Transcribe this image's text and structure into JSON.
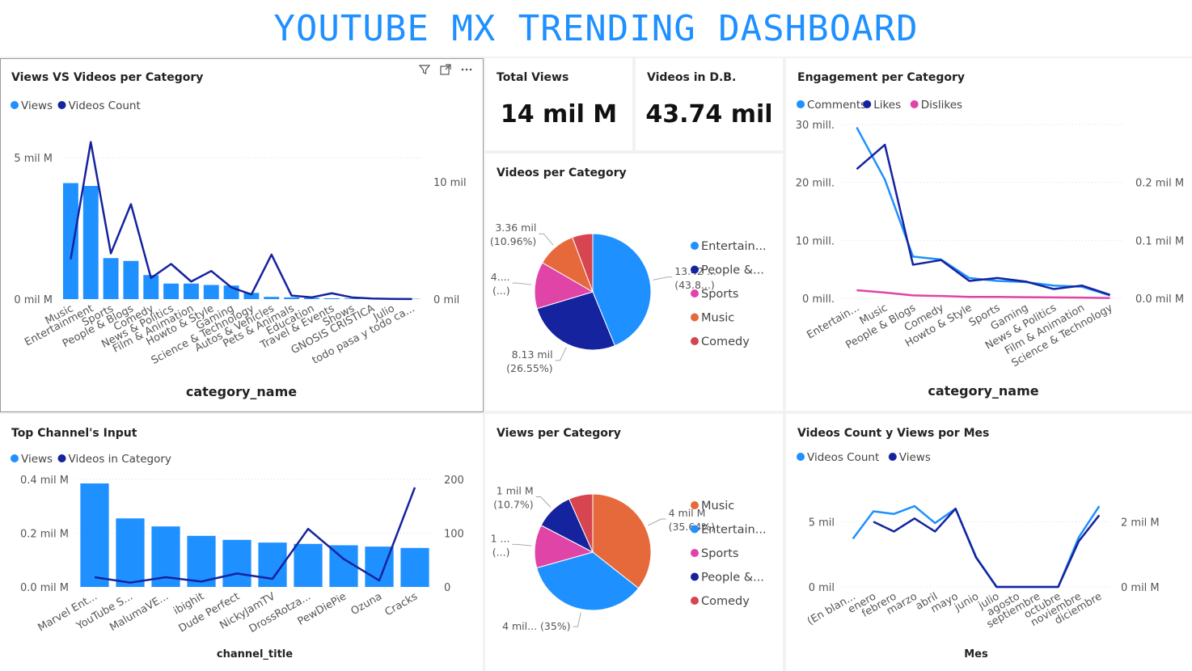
{
  "dashboard_title": "YOUTUBE MX TRENDING DASHBOARD",
  "colors": {
    "views": "#1E90FF",
    "videos": "#15239E",
    "pink": "#E044A7",
    "orange": "#E5693A",
    "red": "#D64550"
  },
  "icons": [
    "filter-icon",
    "focus-mode-icon",
    "more-options-icon"
  ],
  "kpi_total_views": {
    "label": "Total Views",
    "value": "14 mil M"
  },
  "kpi_videos": {
    "label": "Videos in D.B.",
    "value": "43.74 mil"
  },
  "chart_data": [
    {
      "id": "views_vs_videos",
      "type": "bar",
      "title": "Views VS Videos per Category",
      "xlabel": "category_name",
      "legend": [
        "Views",
        "Videos Count"
      ],
      "categories": [
        "Music",
        "Entertainment",
        "Sports",
        "People & Blogs",
        "Comedy",
        "News & Politics",
        "Film & Animation",
        "Howto & Style",
        "Gaming",
        "Science & Technology",
        "Autos & Vehicles",
        "Pets & Animals",
        "Education",
        "Travel & Events",
        "Shows",
        "GNOSIS CRISTICA",
        "Julio",
        "todo pasa y todo ca..."
      ],
      "series": [
        {
          "name": "Views",
          "axis": "left",
          "kind": "bar",
          "values": [
            4.1,
            4.0,
            1.45,
            1.35,
            0.85,
            0.55,
            0.55,
            0.5,
            0.48,
            0.22,
            0.08,
            0.06,
            0.04,
            0.03,
            0.02,
            0.01,
            0.01,
            0.01
          ]
        },
        {
          "name": "Videos Count",
          "axis": "right",
          "kind": "line",
          "values": [
            3.4,
            13.4,
            3.9,
            8.1,
            1.8,
            3.0,
            1.5,
            2.4,
            1.0,
            0.4,
            3.8,
            0.3,
            0.15,
            0.5,
            0.15,
            0.05,
            0.02,
            0.01
          ]
        }
      ],
      "y_left": {
        "min": 0,
        "max": 5.8,
        "ticks": [
          {
            "v": 0,
            "label": "0 mil M"
          },
          {
            "v": 5,
            "label": "5 mil M"
          }
        ]
      },
      "y_right": {
        "min": 0,
        "max": 14,
        "ticks": [
          {
            "v": 0,
            "label": "0 mil"
          },
          {
            "v": 10,
            "label": "10 mil"
          }
        ]
      }
    },
    {
      "id": "videos_per_category",
      "type": "pie",
      "title": "Videos per Category",
      "slices": [
        {
          "name": "Entertainment",
          "legend_label": "Entertain...",
          "value": 43.8,
          "color": "#1E90FF",
          "label1": "13.42 ...",
          "label2": "(43.8...)"
        },
        {
          "name": "People & Blogs",
          "legend_label": "People &...",
          "value": 26.55,
          "color": "#15239E",
          "label1": "8.13 mil",
          "label2": "(26.55%)"
        },
        {
          "name": "Sports",
          "legend_label": "Sports",
          "value": 13.0,
          "color": "#E044A7",
          "label1": "4....",
          "label2": "(...)"
        },
        {
          "name": "Music",
          "legend_label": "Music",
          "value": 10.96,
          "color": "#E5693A",
          "label1": "3.36 mil",
          "label2": "(10.96%)"
        },
        {
          "name": "Comedy",
          "legend_label": "Comedy",
          "value": 5.69,
          "color": "#D64550",
          "label1": "",
          "label2": ""
        }
      ]
    },
    {
      "id": "engagement",
      "type": "line",
      "title": "Engagement per Category",
      "xlabel": "category_name",
      "legend": [
        "Comments",
        "Likes",
        "Dislikes"
      ],
      "categories": [
        "Entertain...",
        "Music",
        "People & Blogs",
        "Comedy",
        "Howto & Style",
        "Sports",
        "Gaming",
        "News & Politics",
        "Film & Animation",
        "Science & Technology"
      ],
      "series": [
        {
          "name": "Comments",
          "axis": "right",
          "values": [
            0.295,
            0.205,
            0.072,
            0.067,
            0.035,
            0.03,
            0.028,
            0.022,
            0.02,
            0.005
          ]
        },
        {
          "name": "Likes",
          "axis": "left",
          "values": [
            22.3,
            26.5,
            5.8,
            6.6,
            3.0,
            3.5,
            2.9,
            1.6,
            2.2,
            0.6
          ]
        },
        {
          "name": "Dislikes",
          "axis": "left",
          "values": [
            1.4,
            1.0,
            0.5,
            0.4,
            0.25,
            0.25,
            0.2,
            0.15,
            0.12,
            0.05
          ]
        }
      ],
      "y_left": {
        "min": 0,
        "max": 30,
        "ticks": [
          {
            "v": 0,
            "label": "0 mill."
          },
          {
            "v": 10,
            "label": "10 mill."
          },
          {
            "v": 20,
            "label": "20 mill."
          },
          {
            "v": 30,
            "label": "30 mill."
          }
        ]
      },
      "y_right": {
        "min": 0,
        "max": 0.3,
        "ticks": [
          {
            "v": 0,
            "label": "0.0 mil M"
          },
          {
            "v": 0.1,
            "label": "0.1 mil M"
          },
          {
            "v": 0.2,
            "label": "0.2 mil M"
          }
        ]
      }
    },
    {
      "id": "top_channels",
      "type": "bar",
      "title": "Top Channel's Input",
      "xlabel": "channel_title",
      "legend": [
        "Views",
        "Videos in Category"
      ],
      "categories": [
        "Marvel Ent...",
        "YouTube S...",
        "MalumaVE...",
        "ibighit",
        "Dude Perfect",
        "NickyJamTV",
        "DrossRotza...",
        "PewDiePie",
        "Ozuna",
        "Cracks"
      ],
      "series": [
        {
          "name": "Views",
          "axis": "left",
          "kind": "bar",
          "values": [
            0.385,
            0.255,
            0.225,
            0.19,
            0.175,
            0.165,
            0.16,
            0.155,
            0.15,
            0.145
          ]
        },
        {
          "name": "Videos in Category",
          "axis": "right",
          "kind": "line",
          "values": [
            18,
            8,
            18,
            10,
            25,
            15,
            108,
            52,
            12,
            185
          ]
        }
      ],
      "y_left": {
        "min": 0,
        "max": 0.4,
        "ticks": [
          {
            "v": 0,
            "label": "0.0 mil M"
          },
          {
            "v": 0.2,
            "label": "0.2 mil M"
          },
          {
            "v": 0.4,
            "label": "0.4 mil M"
          }
        ]
      },
      "y_right": {
        "min": 0,
        "max": 200,
        "ticks": [
          {
            "v": 0,
            "label": "0"
          },
          {
            "v": 100,
            "label": "100"
          },
          {
            "v": 200,
            "label": "200"
          }
        ]
      }
    },
    {
      "id": "views_per_category",
      "type": "pie",
      "title": "Views per Category",
      "slices": [
        {
          "name": "Music",
          "legend_label": "Music",
          "value": 35.64,
          "color": "#E5693A",
          "label1": "4 mil M",
          "label2": "(35.64%)"
        },
        {
          "name": "Entertainment",
          "legend_label": "Entertain...",
          "value": 35.0,
          "color": "#1E90FF",
          "label1": "4 mil... (35%)",
          "label2": ""
        },
        {
          "name": "Sports",
          "legend_label": "Sports",
          "value": 12.0,
          "color": "#E044A7",
          "label1": "1 ...",
          "label2": "(...)"
        },
        {
          "name": "People & Blogs",
          "legend_label": "People &...",
          "value": 10.7,
          "color": "#15239E",
          "label1": "1 mil M",
          "label2": "(10.7%)"
        },
        {
          "name": "Comedy",
          "legend_label": "Comedy",
          "value": 6.66,
          "color": "#D64550",
          "label1": "",
          "label2": ""
        }
      ]
    },
    {
      "id": "monthly",
      "type": "line",
      "title": "Videos Count y Views por Mes",
      "xlabel": "Mes",
      "legend": [
        "Videos Count",
        "Views"
      ],
      "categories": [
        "(En blan...",
        "enero",
        "febrero",
        "marzo",
        "abril",
        "mayo",
        "junio",
        "julio",
        "agosto",
        "septiembre",
        "octubre",
        "noviembre",
        "diciembre"
      ],
      "series": [
        {
          "name": "Videos Count",
          "axis": "left",
          "values": [
            3.7,
            5.8,
            5.6,
            6.2,
            4.9,
            6.0,
            2.3,
            0,
            0,
            0,
            0,
            3.8,
            6.2
          ]
        },
        {
          "name": "Views",
          "axis": "right",
          "values": [
            null,
            2.0,
            1.7,
            2.1,
            1.7,
            2.4,
            0.9,
            0,
            0,
            0,
            0,
            1.4,
            2.2
          ]
        }
      ],
      "y_left": {
        "min": 0,
        "max": 8,
        "ticks": [
          {
            "v": 0,
            "label": "0 mil"
          },
          {
            "v": 5,
            "label": "5 mil"
          }
        ]
      },
      "y_right": {
        "min": 0,
        "max": 3.2,
        "ticks": [
          {
            "v": 0,
            "label": "0 mil M"
          },
          {
            "v": 2,
            "label": "2 mil M"
          }
        ]
      }
    }
  ]
}
